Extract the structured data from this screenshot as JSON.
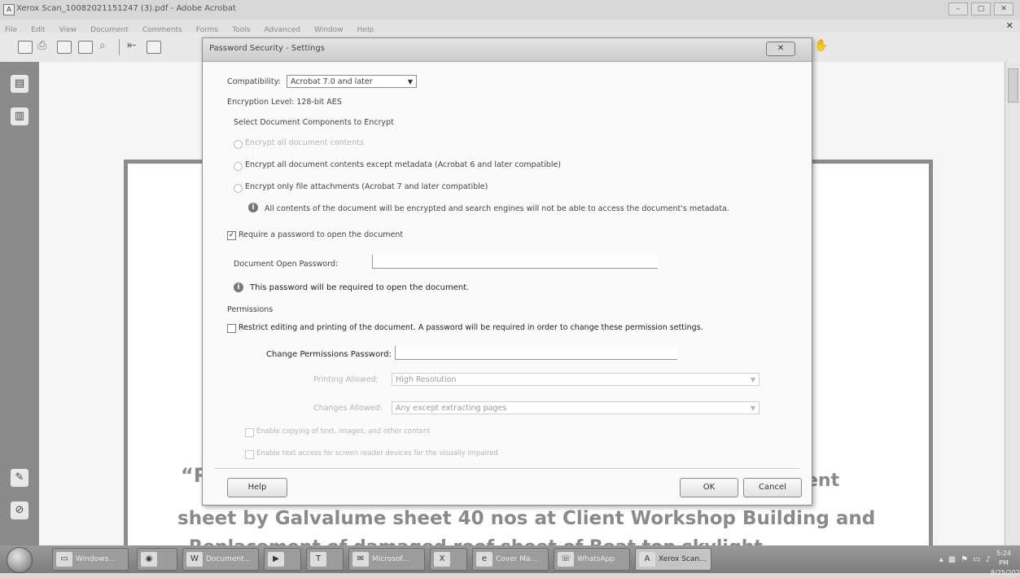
{
  "window": {
    "title": "Xerox Scan_10082021151247 (3).pdf - Adobe Acrobat",
    "controls": [
      "–",
      "▢",
      "✕"
    ]
  },
  "menu": [
    "File",
    "Edit",
    "View",
    "Document",
    "Comments",
    "Forms",
    "Tools",
    "Advanced",
    "Window",
    "Help"
  ],
  "document": {
    "line1_start": "“R",
    "line1_end": "ent",
    "line2": "sheet by Galvalume sheet 40 nos at Client Workshop Building and",
    "line3": "Replacement of damaged roof sheet of Boat top skylight"
  },
  "dialog": {
    "title": "Password Security - Settings",
    "close": "✕",
    "compatibility_label": "Compatibility:",
    "compatibility_value": "Acrobat 7.0 and later",
    "encryption_level": "Encryption Level:  128-bit AES",
    "select_components": "Select Document Components to Encrypt",
    "options": {
      "all": "Encrypt all document contents",
      "except_metadata": "Encrypt all document contents except metadata (Acrobat 6 and later compatible)",
      "attachments": "Encrypt only file attachments (Acrobat 7 and later compatible)"
    },
    "info_note": "All contents of the document will be encrypted and search engines will not be able to access the document's metadata.",
    "require_password_label": "Require a password to open the document",
    "require_password_checked": true,
    "open_password_label": "Document Open Password:",
    "open_password_value": "",
    "open_password_note": "This password will be required to open the document.",
    "permissions_heading": "Permissions",
    "restrict_label": "Restrict editing and printing of the document. A password will be required in order to change these permission settings.",
    "restrict_checked": false,
    "change_permissions_label": "Change Permissions Password:",
    "change_permissions_value": "",
    "printing_allowed_label": "Printing Allowed:",
    "printing_allowed_value": "High Resolution",
    "changes_allowed_label": "Changes Allowed:",
    "changes_allowed_value": "Any except extracting pages",
    "enable_copying": "Enable copying of text, images, and other content",
    "enable_text_access": "Enable text access for screen reader devices for the visually impaired",
    "help_button": "Help",
    "ok_button": "OK",
    "cancel_button": "Cancel"
  },
  "taskbar": {
    "apps": [
      {
        "label": "Windows...",
        "icon": "folder-icon"
      },
      {
        "label": "",
        "icon": "chrome-icon"
      },
      {
        "label": "Document...",
        "icon": "word-icon"
      },
      {
        "label": "",
        "icon": "media-player-icon"
      },
      {
        "label": "",
        "icon": "teams-icon"
      },
      {
        "label": "Microsof...",
        "icon": "outlook-icon"
      },
      {
        "label": "",
        "icon": "excel-icon"
      },
      {
        "label": "Cover Ma...",
        "icon": "explorer-icon"
      },
      {
        "label": "WhatsApp",
        "icon": "whatsapp-icon"
      },
      {
        "label": "Xerox Scan...",
        "icon": "acrobat-icon"
      }
    ],
    "time": "5:24 PM",
    "date": "8/25/2021"
  }
}
